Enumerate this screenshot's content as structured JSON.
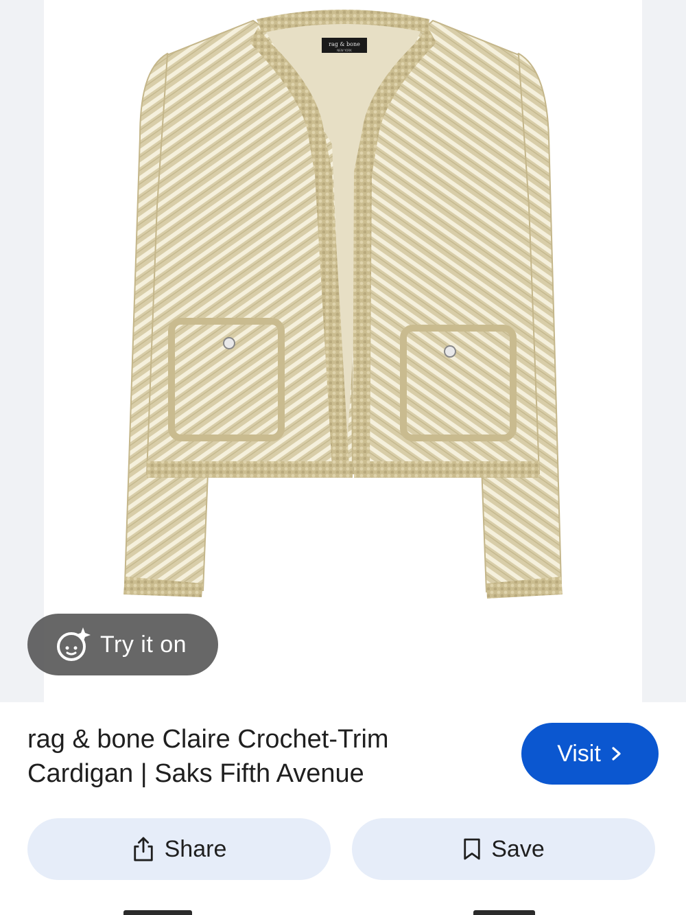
{
  "image": {
    "alt": "rag & bone Claire Crochet-Trim Cardigan",
    "brand_tag": "rag & bone",
    "brand_tag_sub": "NEW YORK",
    "colors": {
      "fabric": "#dcd2b0",
      "stripe": "#f6f1df",
      "trim": "#cdbf92",
      "panel": "#f0f2f5"
    }
  },
  "try_on": {
    "label": "Try it on",
    "icon": "sparkle-face-icon"
  },
  "result": {
    "title_line1": "rag & bone Claire Crochet-Trim",
    "title_line2": "Cardigan | Saks Fifth Avenue"
  },
  "visit": {
    "label": "Visit",
    "icon": "chevron-right-icon",
    "color": "#0b57d0"
  },
  "actions": {
    "share_label": "Share",
    "share_icon": "share-icon",
    "save_label": "Save",
    "save_icon": "bookmark-icon",
    "button_color": "#e6edf9"
  }
}
